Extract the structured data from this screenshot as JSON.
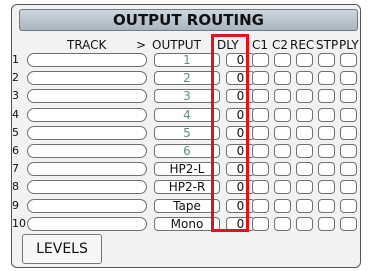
{
  "title": "OUTPUT ROUTING",
  "headers": {
    "track": "TRACK",
    "arrow": ">",
    "output": "OUTPUT",
    "dly": "DLY",
    "c1": "C1",
    "c2": "C2",
    "rec": "REC",
    "stp": "STP",
    "ply": "PLY"
  },
  "rows": [
    {
      "num": "1",
      "output": "1",
      "dly": "0"
    },
    {
      "num": "2",
      "output": "2",
      "dly": "0"
    },
    {
      "num": "3",
      "output": "3",
      "dly": "0"
    },
    {
      "num": "4",
      "output": "4",
      "dly": "0"
    },
    {
      "num": "5",
      "output": "5",
      "dly": "0"
    },
    {
      "num": "6",
      "output": "6",
      "dly": "0"
    },
    {
      "num": "7",
      "output": "HP2-L",
      "dly": "0"
    },
    {
      "num": "8",
      "output": "HP2-R",
      "dly": "0"
    },
    {
      "num": "9",
      "output": "Tape",
      "dly": "0"
    },
    {
      "num": "10",
      "output": "Mono",
      "dly": "0"
    }
  ],
  "levels_label": "LEVELS",
  "colors": {
    "highlight": "#e0131b",
    "numeric_output": "#5f8f87",
    "title_bar": "#b9c3cc"
  }
}
